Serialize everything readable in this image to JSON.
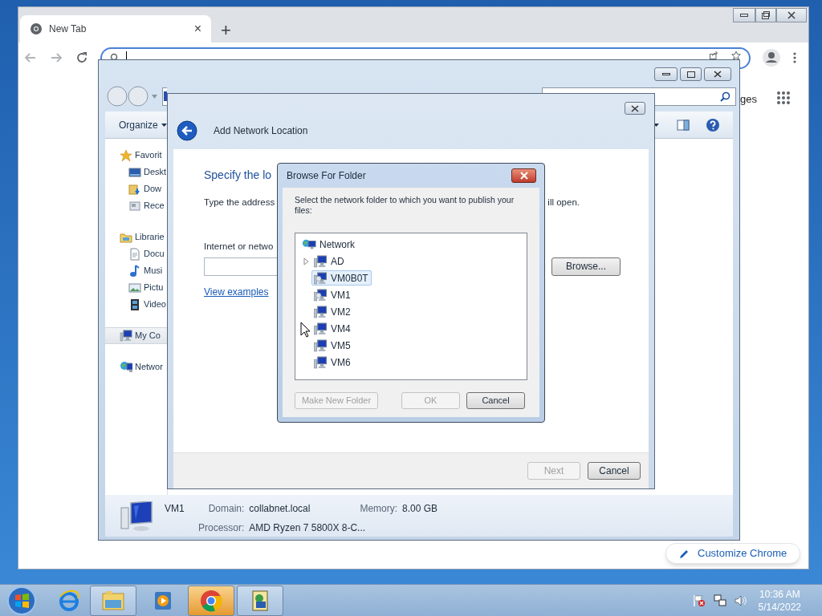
{
  "browser": {
    "tab_title": "New Tab",
    "tab_close": "×",
    "new_tab": "+",
    "partial_link": "ges",
    "customize_button": "Customize Chrome"
  },
  "explorer": {
    "organize": "Organize",
    "nav_groups": [
      {
        "label": "Favorit",
        "kind": "star",
        "selected": false,
        "children": [
          {
            "label": "Deskt",
            "kind": "desktop"
          },
          {
            "label": "Dow",
            "kind": "downloads"
          },
          {
            "label": "Rece",
            "kind": "recent"
          }
        ]
      },
      {
        "label": "Librarie",
        "kind": "library",
        "selected": false,
        "children": [
          {
            "label": "Docu",
            "kind": "document"
          },
          {
            "label": "Musi",
            "kind": "music"
          },
          {
            "label": "Pictu",
            "kind": "pictures"
          },
          {
            "label": "Video",
            "kind": "video"
          }
        ]
      },
      {
        "label": "My Co",
        "kind": "computer",
        "selected": true
      },
      {
        "label": "Networ",
        "kind": "network",
        "selected": false
      }
    ],
    "details": {
      "name": "VM1",
      "fields": [
        {
          "label": "Domain:",
          "value": "collabnet.local"
        },
        {
          "label": "Memory:",
          "value": "8.00 GB"
        },
        {
          "label": "Processor:",
          "value": "AMD Ryzen 7 5800X 8-C..."
        }
      ]
    }
  },
  "wizard": {
    "title": "Add Network Location",
    "heading": "Specify the lo",
    "instruction_left": "Type the address",
    "instruction_right": "ill open.",
    "field_label": "Internet or netwo",
    "browse_button": "Browse...",
    "link": "View examples",
    "buttons": [
      {
        "label": "Next",
        "disabled": true
      },
      {
        "label": "Cancel",
        "disabled": false
      }
    ]
  },
  "browse_dialog": {
    "title": "Browse For Folder",
    "prompt": "Select the network folder to which you want to publish your files:",
    "tree": {
      "label": "Network",
      "children": [
        {
          "label": "AD",
          "expandable": true,
          "shared": false,
          "selected": false
        },
        {
          "label": "VM0B0T",
          "expandable": false,
          "shared": true,
          "selected": true
        },
        {
          "label": "VM1",
          "expandable": false,
          "shared": true,
          "selected": false
        },
        {
          "label": "VM2",
          "expandable": false,
          "shared": false,
          "selected": false
        },
        {
          "label": "VM4",
          "expandable": false,
          "shared": false,
          "selected": false
        },
        {
          "label": "VM5",
          "expandable": false,
          "shared": false,
          "selected": false
        },
        {
          "label": "VM6",
          "expandable": false,
          "shared": false,
          "selected": false
        }
      ]
    },
    "buttons": [
      {
        "label": "Make New Folder",
        "disabled": true
      },
      {
        "label": "OK",
        "disabled": true
      },
      {
        "label": "Cancel",
        "disabled": false
      }
    ]
  },
  "taskbar": {
    "apps": [
      {
        "kind": "ie",
        "running": false,
        "active": false
      },
      {
        "kind": "explorer",
        "running": true,
        "active": false
      },
      {
        "kind": "media",
        "running": false,
        "active": false
      },
      {
        "kind": "chrome",
        "running": true,
        "active": true
      },
      {
        "kind": "network-app",
        "running": true,
        "active": false
      }
    ],
    "time": "10:36 AM",
    "date": "5/14/2022"
  }
}
